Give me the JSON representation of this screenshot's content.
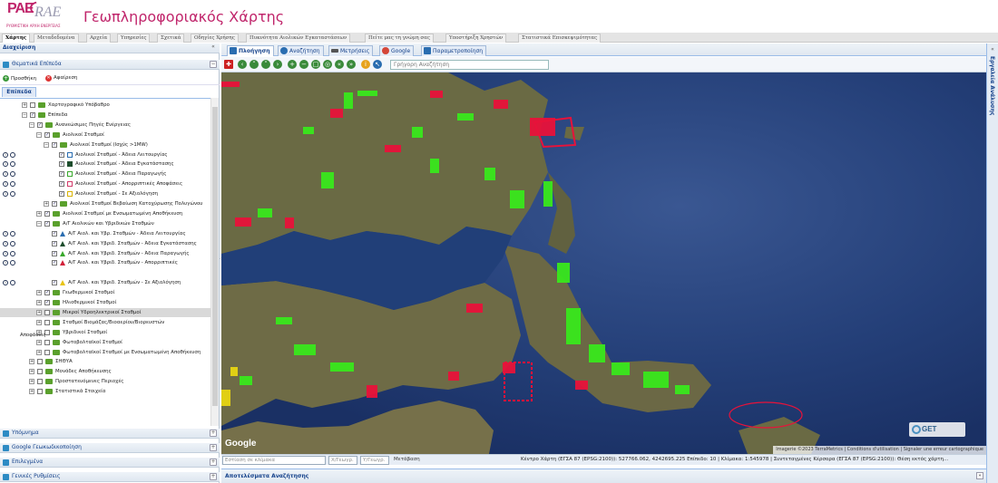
{
  "header": {
    "logo_text_pae": "PAE",
    "logo_text_rae": "RAE",
    "logo_subtitle": "ΡΥΘΜΙΣΤΙΚΗ ΑΡΧΗ ΕΝΕΡΓΕΙΑΣ",
    "title": "Γεωπληροφοριακός Χάρτης"
  },
  "menu": [
    {
      "label": "Χάρτης",
      "active": true
    },
    {
      "label": "Μεταδεδομένα"
    },
    {
      "label": "Αρχεία"
    },
    {
      "label": "Υπηρεσίες"
    },
    {
      "label": "Σχετικά"
    },
    {
      "label": "Οδηγίες Χρήσης"
    },
    {
      "label": "Πυκνότητα Αιολικών Εγκαταστάσεων"
    },
    {
      "label": "Πείτε μας τη γνώμη σας"
    },
    {
      "label": "Υποστήριξη Χρηστών"
    },
    {
      "label": "Στατιστικά Επισκεψιμότητας"
    }
  ],
  "left_panel": {
    "title": "Διαχείριση",
    "collapse_symbol": "«",
    "thematic_layers": "Θεματικά Επίπεδα",
    "add_label": "Προσθήκη",
    "remove_label": "Αφαίρεση",
    "layers_tab": "Επίπεδα",
    "decisions_label": "Αποφάσεις",
    "tree": [
      {
        "indent": 1,
        "exp": "+",
        "checked": false,
        "label": "Χαρτογραφικό Υπόβαθρο"
      },
      {
        "indent": 1,
        "exp": "−",
        "checked": true,
        "label": "Επίπεδα"
      },
      {
        "indent": 2,
        "exp": "−",
        "checked": true,
        "label": "Ανανεώσιμες Πηγές Ενέργειας"
      },
      {
        "indent": 3,
        "exp": "−",
        "checked": true,
        "label": "Αιολικοί Σταθμοί"
      },
      {
        "indent": 4,
        "exp": "−",
        "checked": true,
        "label": "Αιολικοί Σταθμοί (Ισχύς >1MW)"
      },
      {
        "indent": 5,
        "checked": true,
        "sym": "sq-blue",
        "info": true,
        "label": "Αιολικοί Σταθμοί - Άδεια Λειτουργίας"
      },
      {
        "indent": 5,
        "checked": true,
        "sym": "sq-dark",
        "info": true,
        "label": "Αιολικοί Σταθμοί - Άδεια Εγκατάστασης"
      },
      {
        "indent": 5,
        "checked": true,
        "sym": "sq-green",
        "info": true,
        "label": "Αιολικοί Σταθμοί - Άδεια Παραγωγής"
      },
      {
        "indent": 5,
        "checked": true,
        "sym": "sq-pink",
        "info": true,
        "label": "Αιολικοί Σταθμοί - Απορριπτικές Αποφάσεις"
      },
      {
        "indent": 5,
        "checked": true,
        "sym": "sq-yellow",
        "info": true,
        "label": "Αιολικοί Σταθμοί - Σε Αξιολόγηση"
      },
      {
        "indent": 4,
        "exp": "+",
        "checked": true,
        "label": "Αιολικοί Σταθμοί Βεβαίωση Κατοχύρωσης Πολυγώνου"
      },
      {
        "indent": 3,
        "exp": "+",
        "checked": true,
        "label": "Αιολικοί Σταθμοί με Ενσωματωμένη Αποθήκευση"
      },
      {
        "indent": 3,
        "exp": "−",
        "checked": true,
        "label": "Α/Γ Αιολικών και Υβριδικών Σταθμών"
      },
      {
        "indent": 4,
        "checked": true,
        "sym": "tri-blue",
        "info": true,
        "label": "Α/Γ Αιολ. και Υβρ. Σταθμών - Άδεια Λειτουργίας"
      },
      {
        "indent": 4,
        "checked": true,
        "sym": "tri-dark",
        "info": true,
        "label": "Α/Γ Αιολ. και Υβριδ. Σταθμών - Άδεια Εγκατάστασης"
      },
      {
        "indent": 4,
        "checked": true,
        "sym": "tri-green",
        "info": true,
        "label": "Α/Γ Αιολ. και Υβριδ. Σταθμών - Άδεια Παραγωγής"
      },
      {
        "indent": 4,
        "checked": true,
        "sym": "tri-red",
        "info": true,
        "label": "Α/Γ Αιολ. και Υβριδ. Σταθμών - Απορριπτικές"
      },
      {
        "indent": 4,
        "gap": true,
        "label": ""
      },
      {
        "indent": 4,
        "checked": true,
        "sym": "tri-yellow",
        "info": true,
        "label": "Α/Γ Αιολ. και Υβριδ. Σταθμών - Σε Αξιολόγηση"
      },
      {
        "indent": 3,
        "exp": "+",
        "checked": true,
        "label": "Γεωθερμικοί Σταθμοί"
      },
      {
        "indent": 3,
        "exp": "+",
        "checked": true,
        "label": "Ηλιοθερμικοί Σταθμοί"
      },
      {
        "indent": 3,
        "exp": "+",
        "checked": false,
        "label": "Μικροί Υδροηλεκτρικοί Σταθμοί",
        "selected": true
      },
      {
        "indent": 3,
        "exp": "+",
        "checked": false,
        "label": "Σταθμοί Βιομάζας/Βιοαερίου/Βιορευστών"
      },
      {
        "indent": 3,
        "exp": "+",
        "checked": false,
        "label": "Υβριδικοί Σταθμοί"
      },
      {
        "indent": 3,
        "exp": "+",
        "checked": false,
        "label": "Φωτοβολταϊκοί Σταθμοί"
      },
      {
        "indent": 3,
        "exp": "+",
        "checked": false,
        "label": "Φωτοβολταϊκοί Σταθμοί με Ενσωματωμένη Αποθήκευση"
      },
      {
        "indent": 2,
        "exp": "+",
        "checked": false,
        "label": "ΣΗΘΥΑ"
      },
      {
        "indent": 2,
        "exp": "+",
        "checked": false,
        "label": "Μονάδες Αποθήκευσης"
      },
      {
        "indent": 2,
        "exp": "+",
        "checked": false,
        "label": "Προστατευόμενες Περιοχές"
      },
      {
        "indent": 2,
        "exp": "+",
        "checked": false,
        "label": "Στατιστικά Στοιχεία"
      }
    ],
    "bottom_sections": [
      "Υπόμνημα",
      "Google Γεωκωδικοποίηση",
      "Επιλεγμένα",
      "Γενικές Ρυθμίσεις"
    ],
    "expand_symbol": "+"
  },
  "map_tabs": [
    {
      "label": "Πλοήγηση",
      "active": true,
      "color": "#2a6db0"
    },
    {
      "label": "Αναζήτηση",
      "color": "#2a6db0"
    },
    {
      "label": "Μετρήσεις",
      "color": "#555555"
    },
    {
      "label": "Google",
      "color": "#d44638"
    },
    {
      "label": "Παραμετροποίηση",
      "color": "#2a6db0"
    }
  ],
  "toolbar": {
    "quick_search_placeholder": "Γρήγορη Αναζήτηση"
  },
  "map": {
    "google_logo": "Google",
    "attribution": "Imagerie ©2023 TerraMetrics | Conditions d'utilisation | Signaler une erreur cartographique",
    "get_logo": "GET"
  },
  "status": {
    "focus_placeholder": "Εστίαση σε κλίμακα",
    "lon_placeholder": "Χ/Γεωγρ.",
    "lat_placeholder": "Υ/Γεωγρ.",
    "go_label": "Μετάβαση",
    "coords_text": "Κέντρο Χάρτη (ΕΓΣΑ 87 (EPSG:2100)): 527766.062, 4242695.225 Επίπεδο: 10 | Κλίμακα: 1:545978 | Συντεταγμένες Κέρσορα (ΕΓΣΑ 87 (EPSG:2100)): Θέση εκτός χάρτη..."
  },
  "results": {
    "title": "Αποτελέσματα Αναζήτησης",
    "toggle": "»"
  },
  "right_strip": {
    "title": "Εργαλεία Ανάλυσης",
    "toggle": "«"
  },
  "colors": {
    "brand": "#c0256b",
    "panel_text": "#15428b",
    "sea": "#1c3466",
    "land": "#6b6a4a",
    "wind_green": "#39e81c",
    "wind_red": "#e8123a"
  }
}
